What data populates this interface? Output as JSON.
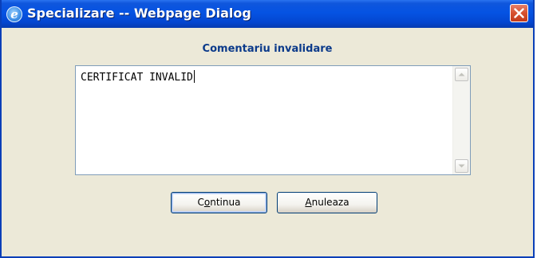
{
  "window": {
    "title": "Specializare -- Webpage Dialog",
    "icon": "ie-icon",
    "close_icon": "close-icon"
  },
  "dialog": {
    "heading": "Comentariu invalidare",
    "textarea_value": "CERTIFICAT INVALID",
    "buttons": {
      "continue": {
        "label_before": "C",
        "label_ul": "o",
        "label_after": "ntinua"
      },
      "cancel": {
        "label_before": "",
        "label_ul": "A",
        "label_after": "nuleaza"
      }
    }
  },
  "colors": {
    "titlebar": "#0553e3",
    "close_button": "#d6502e",
    "dialog_background": "#ece9d8",
    "heading_text": "#0b3a8a"
  }
}
